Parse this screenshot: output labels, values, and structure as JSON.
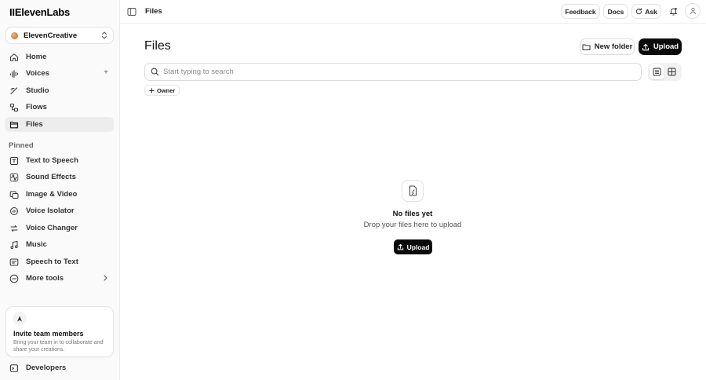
{
  "app": {
    "logo_text": "IIElevenLabs"
  },
  "workspace": {
    "name": "ElevenCreative",
    "color": "#d9874a"
  },
  "sidebar": {
    "main_items": [
      {
        "label": "Home",
        "icon": "home-icon"
      },
      {
        "label": "Voices",
        "icon": "voices-icon",
        "action": "+"
      },
      {
        "label": "Studio",
        "icon": "studio-icon"
      },
      {
        "label": "Flows",
        "icon": "flows-icon"
      },
      {
        "label": "Files",
        "icon": "files-icon",
        "active": true
      }
    ],
    "pinned_heading": "Pinned",
    "pinned_items": [
      {
        "label": "Text to Speech",
        "icon": "text-to-speech-icon"
      },
      {
        "label": "Sound Effects",
        "icon": "sound-effects-icon"
      },
      {
        "label": "Image & Video",
        "icon": "image-video-icon"
      },
      {
        "label": "Voice Isolator",
        "icon": "voice-isolator-icon"
      },
      {
        "label": "Voice Changer",
        "icon": "voice-changer-icon"
      },
      {
        "label": "Music",
        "icon": "music-icon"
      },
      {
        "label": "Speech to Text",
        "icon": "speech-to-text-icon"
      },
      {
        "label": "More tools",
        "icon": "more-tools-icon"
      }
    ],
    "invite": {
      "title": "Invite team members",
      "description": "Bring your team in to collaborate and share your creations."
    },
    "developers_label": "Developers"
  },
  "topbar": {
    "breadcrumb": "Files",
    "feedback_label": "Feedback",
    "docs_label": "Docs",
    "ask_label": "Ask"
  },
  "main": {
    "title": "Files",
    "new_folder_label": "New folder",
    "upload_label": "Upload",
    "search_placeholder": "Start typing to search",
    "filter_owner_label": "Owner",
    "empty": {
      "title": "No files yet",
      "subtitle": "Drop your files here to upload",
      "upload_label": "Upload"
    }
  },
  "colors": {
    "accent": "#0b0b0b",
    "active_nav_bg": "#ededed",
    "sidebar_bg": "#fafafa"
  }
}
